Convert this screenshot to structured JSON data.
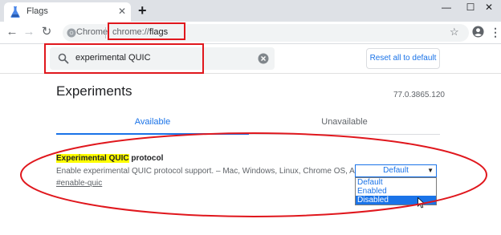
{
  "tab": {
    "title": "Flags",
    "close": "✕",
    "new_tab": "+"
  },
  "window_controls": {
    "minimize": "—",
    "maximize": "☐",
    "close": "✕"
  },
  "toolbar": {
    "back": "←",
    "forward": "→",
    "reload": "↻",
    "star": "☆",
    "menu": "⋮"
  },
  "omnibox": {
    "scheme_label": "Chrome",
    "url_prefix": "chrome://",
    "url_path": "flags"
  },
  "search": {
    "value": "experimental QUIC"
  },
  "reset_button": "Reset all to default",
  "page": {
    "title": "Experiments",
    "version": "77.0.3865.120"
  },
  "tabs": {
    "available": "Available",
    "unavailable": "Unavailable"
  },
  "experiment": {
    "name_highlight": "Experimental QUIC",
    "name_rest": " protocol",
    "description": "Enable experimental QUIC protocol support. – Mac, Windows, Linux, Chrome OS, Android",
    "link": "#enable-quic",
    "select_value": "Default",
    "options": [
      "Default",
      "Enabled",
      "Disabled"
    ],
    "highlighted_option": "Disabled"
  },
  "colors": {
    "accent": "#1a73e8",
    "annotation": "#e0171d",
    "highlight": "#ffff00"
  }
}
